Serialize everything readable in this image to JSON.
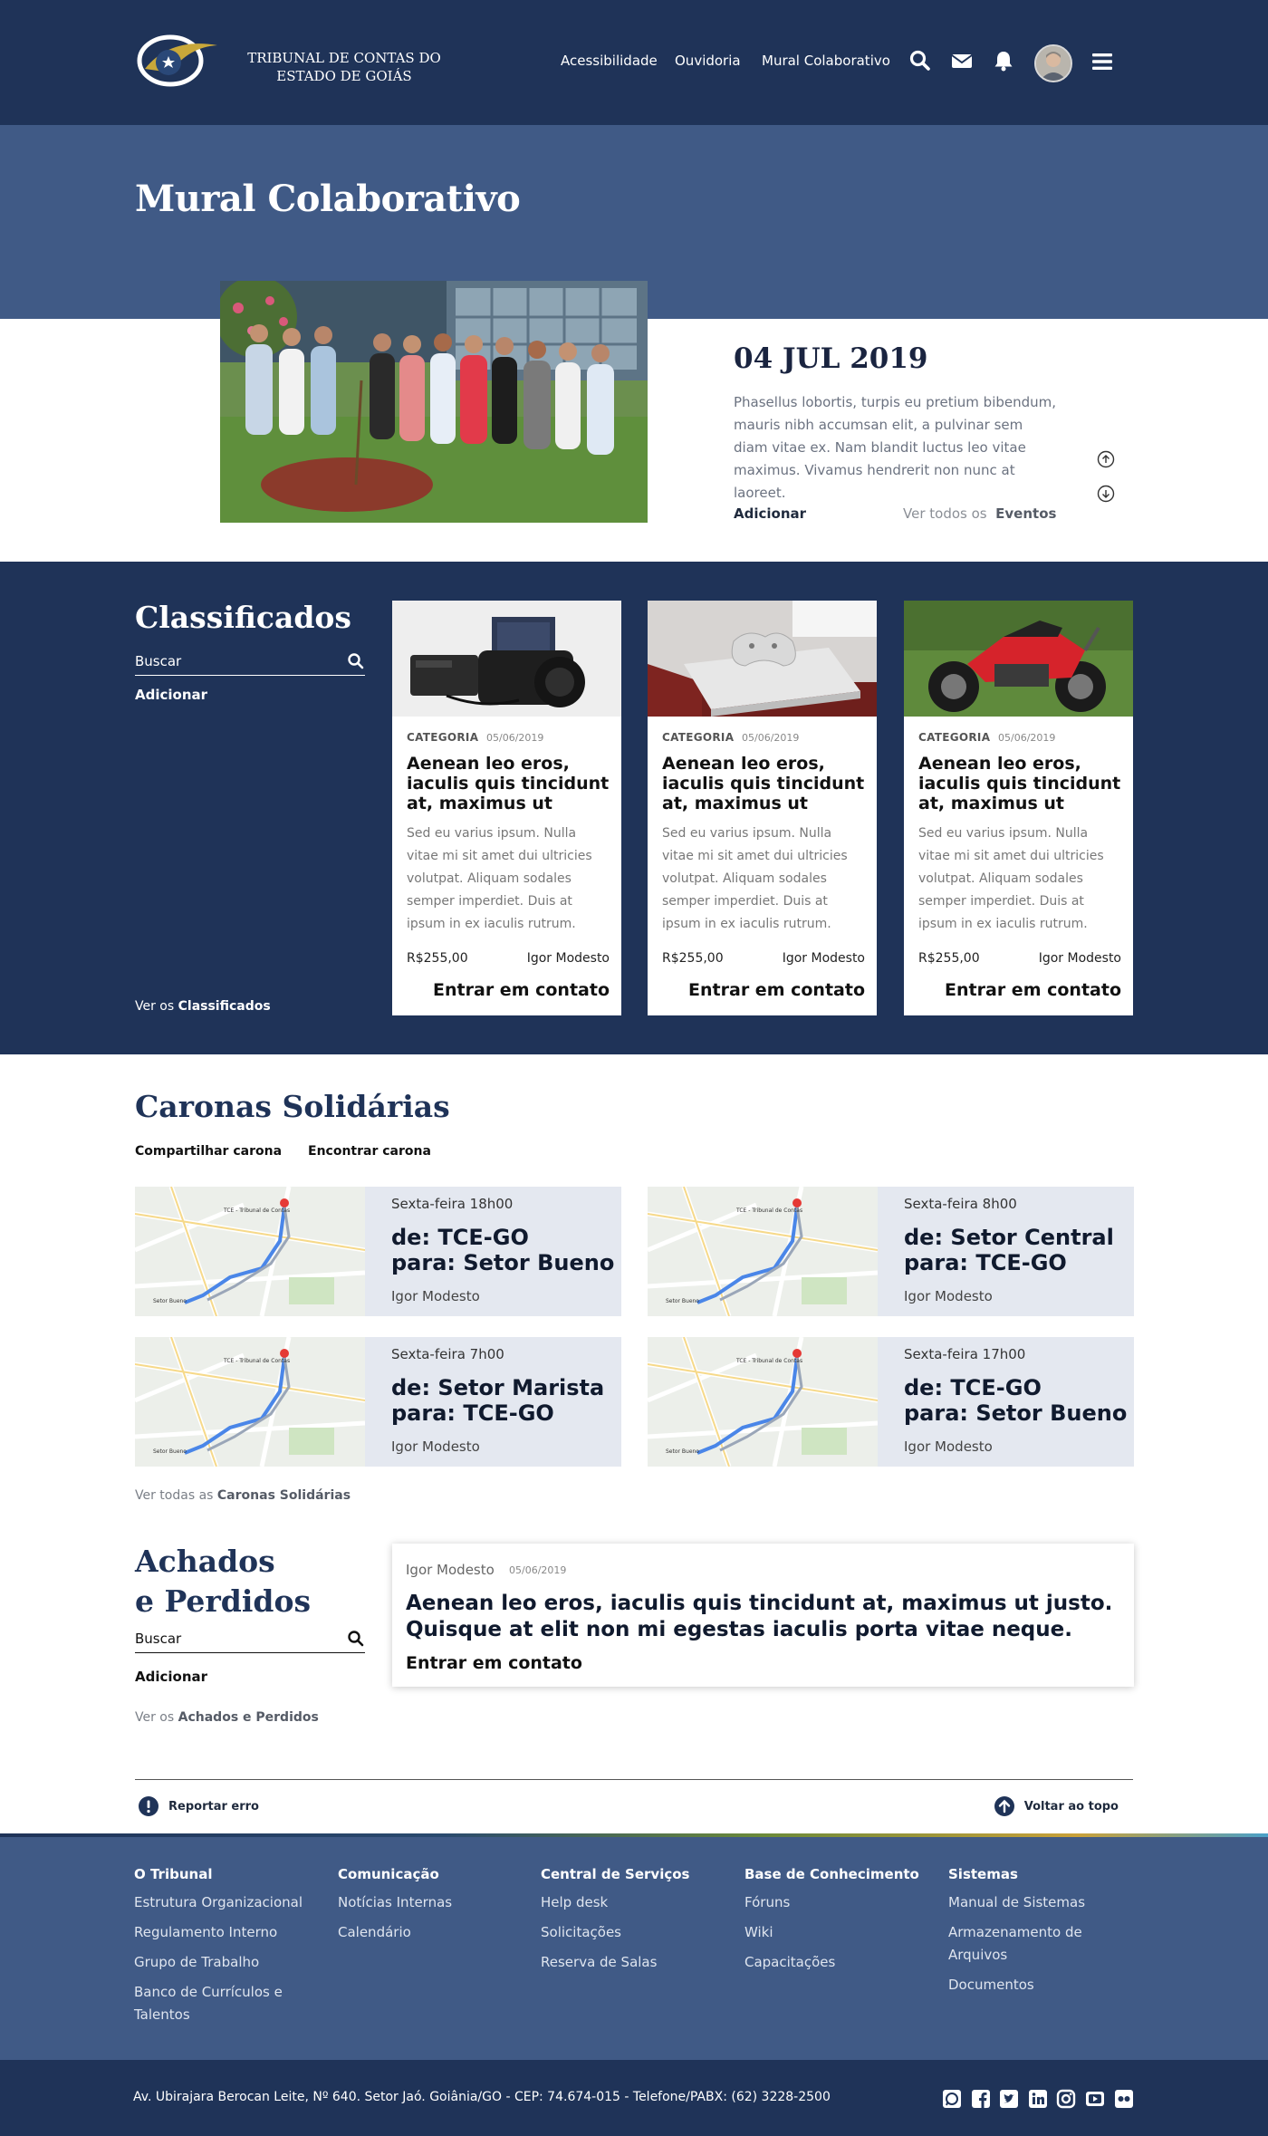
{
  "header": {
    "logo_text": "TRIBUNAL DE CONTAS DO ESTADO DE GOIÁS",
    "nav": [
      "Acessibilidade",
      "Ouvidoria",
      "Mural Colaborativo"
    ],
    "icons": [
      "search-icon",
      "mail-icon",
      "bell-icon",
      "avatar",
      "menu-icon"
    ]
  },
  "mural": {
    "title": "Mural Colaborativo",
    "date": "04 JUL 2019",
    "description": "Phasellus lobortis, turpis eu pretium bibendum, mauris nibh accumsan elit, a pulvinar sem diam vitae ex. Nam blandit luctus leo vitae maximus. Vivamus hendrerit non nunc at laoreet.",
    "add_label": "Adicionar",
    "see_all_prefix": "Ver todos os",
    "see_all_link": "Eventos"
  },
  "classificados": {
    "title": "Classificados",
    "search_placeholder": "Buscar",
    "add_label": "Adicionar",
    "see_all_prefix": "Ver os",
    "see_all_link": "Classificados",
    "items": [
      {
        "category": "CATEGORIA",
        "date": "05/06/2019",
        "title": "Aenean leo eros, iaculis quis tincidunt at, maximus ut",
        "body": "Sed eu varius ipsum. Nulla vitae mi sit amet dui ultricies volutpat. Aliquam sodales semper imperdiet. Duis at ipsum in ex iaculis rutrum.",
        "price": "R$255,00",
        "seller": "Igor Modesto",
        "contact": "Entrar em contato",
        "image": "camera"
      },
      {
        "category": "CATEGORIA",
        "date": "05/06/2019",
        "title": "Aenean leo eros, iaculis quis tincidunt at, maximus ut",
        "body": "Sed eu varius ipsum. Nulla vitae mi sit amet dui ultricies volutpat. Aliquam sodales semper imperdiet. Duis at ipsum in ex iaculis rutrum.",
        "price": "R$255,00",
        "seller": "Igor Modesto",
        "contact": "Entrar em contato",
        "image": "game-console"
      },
      {
        "category": "CATEGORIA",
        "date": "05/06/2019",
        "title": "Aenean leo eros, iaculis quis tincidunt at, maximus ut",
        "body": "Sed eu varius ipsum. Nulla vitae mi sit amet dui ultricies volutpat. Aliquam sodales semper imperdiet. Duis at ipsum in ex iaculis rutrum.",
        "price": "R$255,00",
        "seller": "Igor Modesto",
        "contact": "Entrar em contato",
        "image": "motorcycle"
      }
    ]
  },
  "caronas": {
    "title": "Caronas Solidárias",
    "tabs": [
      "Compartilhar carona",
      "Encontrar carona"
    ],
    "rides": [
      {
        "when": "Sexta-feira 18h00",
        "from": "de: TCE-GO",
        "to": "para: Setor Bueno",
        "driver": "Igor Modesto"
      },
      {
        "when": "Sexta-feira  8h00",
        "from": "de: Setor Central",
        "to": "para: TCE-GO",
        "driver": "Igor Modesto"
      },
      {
        "when": "Sexta-feira  7h00",
        "from": "de: Setor Marista",
        "to": "para: TCE-GO",
        "driver": "Igor Modesto"
      },
      {
        "when": "Sexta-feira  17h00",
        "from": "de: TCE-GO",
        "to": "para: Setor Bueno",
        "driver": "Igor Modesto"
      }
    ],
    "see_all_prefix": "Ver todas as",
    "see_all_link": "Caronas Solidárias"
  },
  "achados": {
    "title_line1": "Achados",
    "title_line2": "e Perdidos",
    "search_placeholder": "Buscar",
    "add_label": "Adicionar",
    "see_all_prefix": "Ver os",
    "see_all_link": "Achados e Perdidos",
    "item": {
      "author": "Igor Modesto",
      "date": "05/06/2019",
      "text": "Aenean leo eros, iaculis quis tincidunt at, maximus ut justo. Quisque at elit non mi egestas iaculis porta vitae neque.",
      "contact": "Entrar em contato"
    }
  },
  "utility": {
    "report_error": "Reportar erro",
    "back_to_top": "Voltar ao topo"
  },
  "footer": {
    "columns": [
      {
        "heading": "O Tribunal",
        "links": [
          "Estrutura Organizacional",
          "Regulamento Interno",
          "Grupo de Trabalho",
          "Banco de Currículos e Talentos"
        ]
      },
      {
        "heading": "Comunicação",
        "links": [
          "Notícias Internas",
          "Calendário"
        ]
      },
      {
        "heading": "Central de Serviços",
        "links": [
          "Help desk",
          "Solicitações",
          "Reserva de Salas"
        ]
      },
      {
        "heading": "Base de Conhecimento",
        "links": [
          "Fóruns",
          "Wiki",
          "Capacitações"
        ]
      },
      {
        "heading": "Sistemas",
        "links": [
          "Manual de Sistemas",
          "Armazenamento de Arquivos",
          "Documentos"
        ]
      }
    ],
    "address": "Av. Ubirajara Berocan Leite, Nº 640. Setor Jaó. Goiânia/GO - CEP: 74.674-015 - Telefone/PABX: (62) 3228-2500",
    "social": [
      "whatsapp-icon",
      "facebook-icon",
      "twitter-icon",
      "linkedin-icon",
      "instagram-icon",
      "youtube-icon",
      "flickr-icon"
    ]
  },
  "colors": {
    "navy": "#1f3358",
    "mid_blue": "#405a86",
    "ride_card_bg": "#e4e8f0"
  }
}
